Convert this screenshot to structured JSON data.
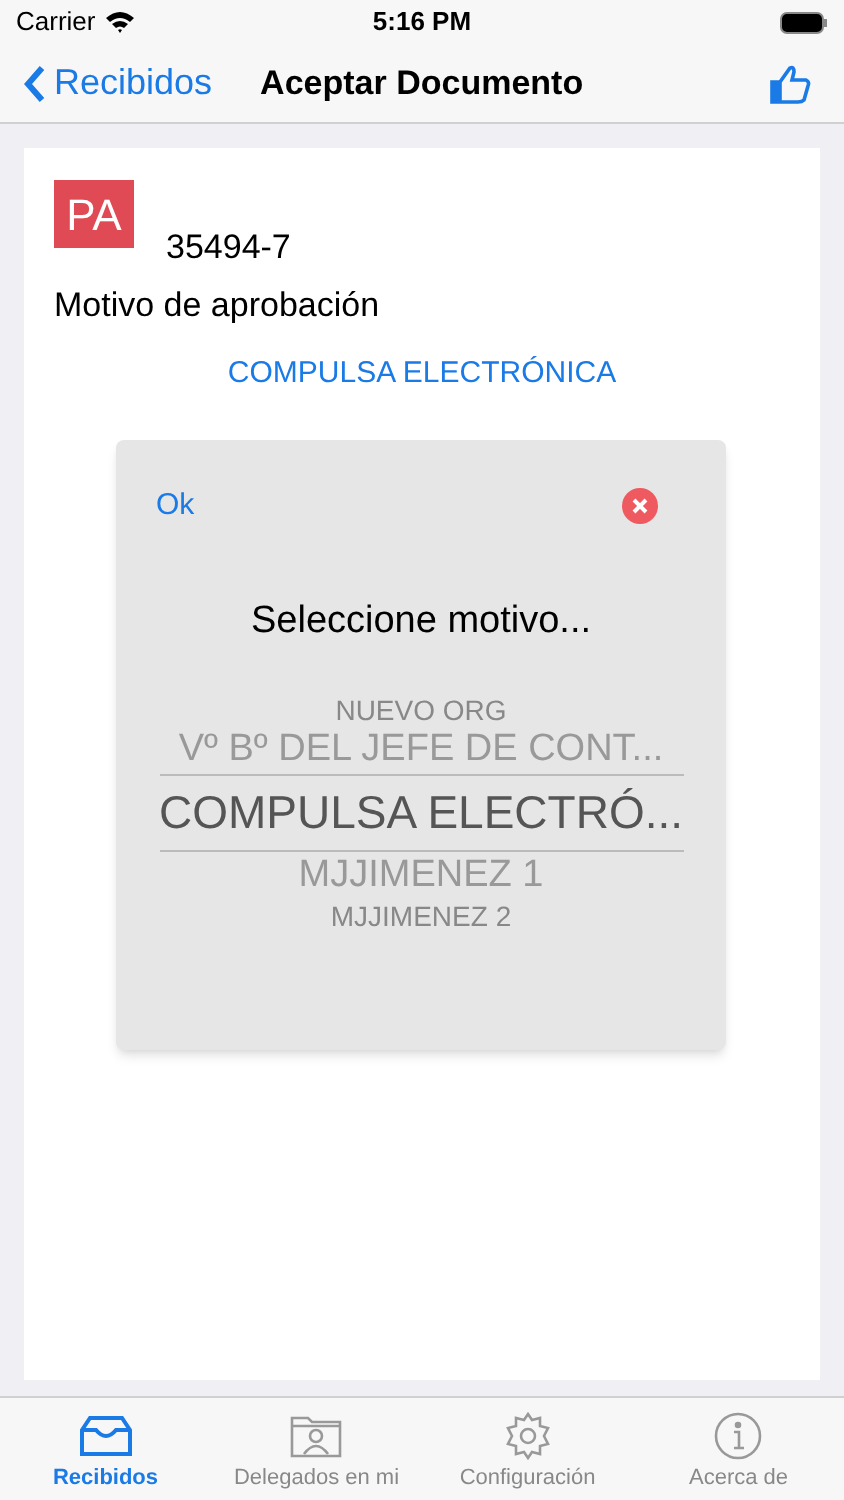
{
  "status_bar": {
    "carrier": "Carrier",
    "time": "5:16 PM"
  },
  "nav": {
    "back": "Recibidos",
    "title": "Aceptar Documento"
  },
  "document": {
    "badge": "PA",
    "number": "35494-7",
    "label": "Motivo de aprobación",
    "selected_reason": "COMPULSA ELECTRÓNICA"
  },
  "dialog": {
    "ok": "Ok",
    "title": "Seleccione motivo...",
    "picker": [
      {
        "label": "NUEVO ORG",
        "selected": false
      },
      {
        "label": "Vº Bº DEL JEFE DE CONT...",
        "selected": false
      },
      {
        "label": "COMPULSA ELECTRÓ...",
        "selected": true
      },
      {
        "label": "MJJIMENEZ 1",
        "selected": false
      },
      {
        "label": "MJJIMENEZ 2",
        "selected": false
      }
    ]
  },
  "tabs": [
    {
      "label": "Recibidos",
      "selected": true,
      "kind": "inbox"
    },
    {
      "label": "Delegados en mi",
      "selected": false,
      "kind": "folder"
    },
    {
      "label": "Configuración",
      "selected": false,
      "kind": "gear"
    },
    {
      "label": "Acerca de",
      "selected": false,
      "kind": "info"
    }
  ]
}
